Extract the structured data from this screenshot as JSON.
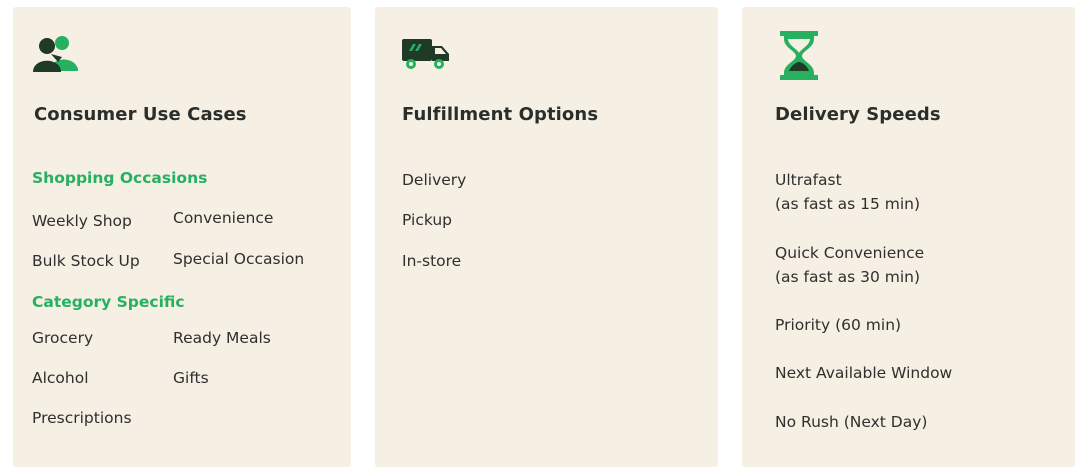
{
  "colors": {
    "card_bg": "#f6efe4",
    "accent_green": "#26b060",
    "dark_green": "#1f3a26",
    "text": "#2f2f2f"
  },
  "cards": [
    {
      "icon": "people-icon",
      "title": "Consumer Use Cases",
      "sections": [
        {
          "heading": "Shopping Occasions",
          "items": [
            "Weekly Shop",
            "Convenience",
            "Bulk Stock Up",
            "Special Occasion"
          ]
        },
        {
          "heading": "Category Specific",
          "items": [
            "Grocery",
            "Ready Meals",
            "Alcohol",
            "Gifts",
            "Prescriptions"
          ]
        }
      ]
    },
    {
      "icon": "delivery-truck-icon",
      "title": "Fulfillment Options",
      "items": [
        "Delivery",
        "Pickup",
        "In-store"
      ]
    },
    {
      "icon": "hourglass-icon",
      "title": "Delivery Speeds",
      "items": [
        {
          "label": "Ultrafast",
          "detail": "(as fast as 15 min)"
        },
        {
          "label": "Quick Convenience",
          "detail": "(as fast as 30 min)"
        },
        {
          "label": "Priority (60 min)"
        },
        {
          "label": "Next Available Window"
        },
        {
          "label": "No Rush (Next Day)"
        }
      ]
    }
  ]
}
